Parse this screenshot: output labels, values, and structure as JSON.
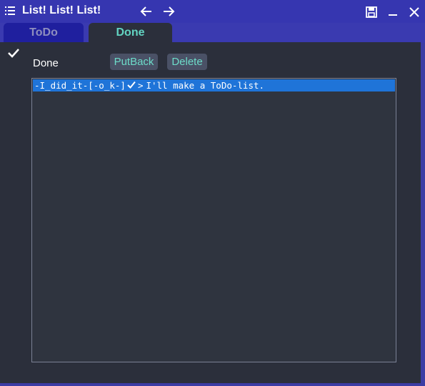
{
  "window": {
    "title": "List! List! List!",
    "icons": {
      "app": "list-icon",
      "back": "arrow-left-icon",
      "forward": "arrow-right-icon",
      "save": "save-icon",
      "minimize": "minimize-icon",
      "close": "close-icon"
    }
  },
  "tabs": [
    {
      "label": "ToDo",
      "selected": false
    },
    {
      "label": "Done",
      "selected": true
    }
  ],
  "done_panel": {
    "check_icon": "checkmark-icon",
    "heading": "Done",
    "putback_label": "PutBack",
    "delete_label": "Delete",
    "items": [
      {
        "date": "-I_did_it-[-o_k-]",
        "check_icon": "check-icon",
        "separator": ">",
        "text": "I'll make a ToDo-list.",
        "selected": true
      }
    ]
  },
  "colors": {
    "title_bar": "#3636b0",
    "panel_bg": "#2b2f3b",
    "accent_teal": "#62d3c1",
    "selection_blue": "#1f74d8"
  }
}
